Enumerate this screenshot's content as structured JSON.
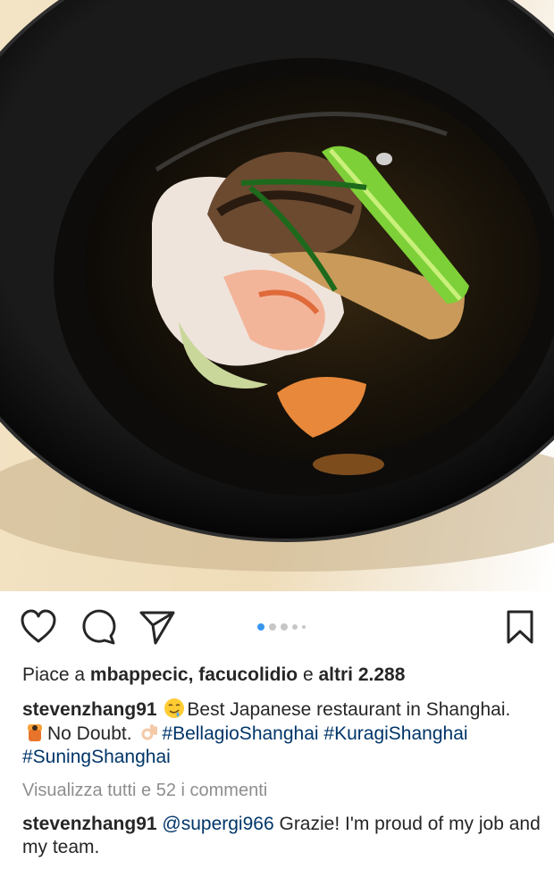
{
  "post": {
    "likes": {
      "prefix": "Piace a ",
      "user1": "mbappecic",
      "separator": ", ",
      "user2": "facucolidio",
      "connector": " e ",
      "others": "altri 2.288"
    },
    "caption": {
      "username": "stevenzhang91",
      "text1": "Best Japanese restaurant in Shanghai.",
      "text2": "No Doubt.",
      "hashtag1": "#BellagioShanghai",
      "hashtag2": "#KuragiShanghai",
      "hashtag3": "#SuningShanghai",
      "emoji1": "drooling-face-emoji",
      "emoji2": "person-bowing-emoji",
      "emoji3": "ok-hand-emoji"
    },
    "view_all_comments": "Visualizza tutti e 52 i commenti",
    "comment": {
      "username": "stevenzhang91",
      "mention": "@supergi966",
      "text": "Grazie! I'm proud of my job and my team."
    },
    "carousel": {
      "count": 5,
      "active_index": 0
    },
    "icons": [
      "heart-icon",
      "comment-icon",
      "share-icon",
      "bookmark-icon"
    ],
    "colors": {
      "link": "#003569",
      "active_dot": "#3897f0",
      "muted": "#8e8e8e"
    }
  }
}
